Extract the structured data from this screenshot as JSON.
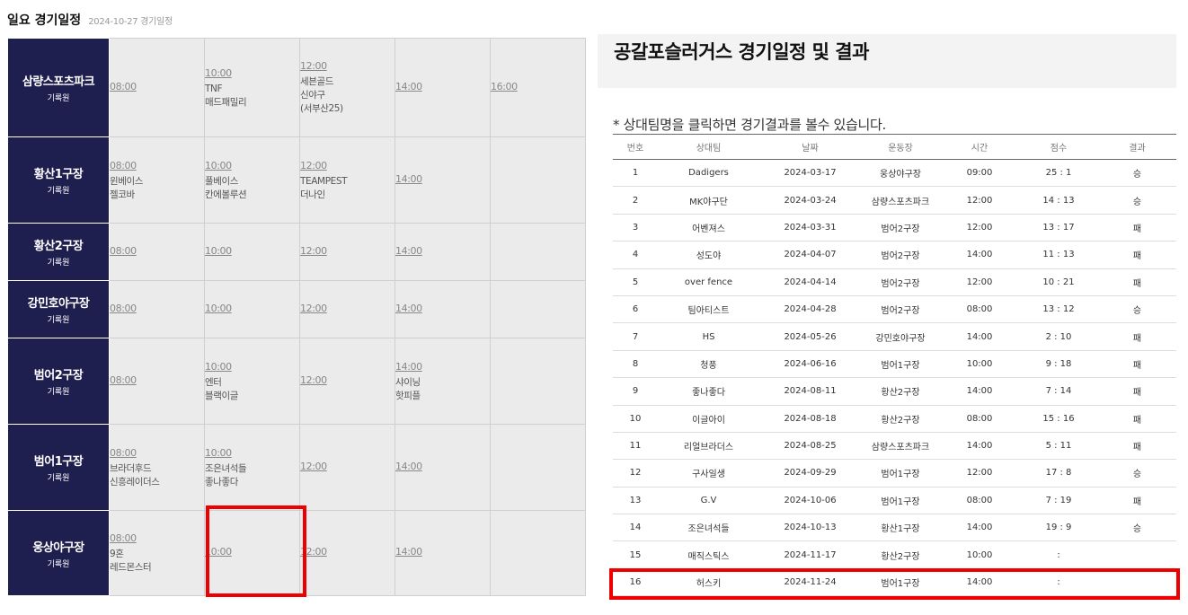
{
  "left": {
    "title": "일요 경기일정",
    "date": "2024-10-27 경기일정",
    "venues": [
      {
        "name": "삼량스포츠파크",
        "sub": "기록원",
        "slots": [
          {
            "time": "08:00",
            "teams": []
          },
          {
            "time": "10:00",
            "teams": [
              "TNF",
              "매드패밀리"
            ]
          },
          {
            "time": "12:00",
            "teams": [
              "세븐골드",
              "신야구",
              "(서부산25)"
            ]
          },
          {
            "time": "14:00",
            "teams": []
          },
          {
            "time": "16:00",
            "teams": []
          }
        ]
      },
      {
        "name": "황산1구장",
        "sub": "기록원",
        "slots": [
          {
            "time": "08:00",
            "teams": [
              "윈베이스",
              "젤코바"
            ]
          },
          {
            "time": "10:00",
            "teams": [
              "풀베이스",
              "칸에볼루션"
            ]
          },
          {
            "time": "12:00",
            "teams": [
              "TEAMPEST",
              "더나인"
            ]
          },
          {
            "time": "14:00",
            "teams": []
          },
          {
            "time": "",
            "teams": []
          }
        ]
      },
      {
        "name": "황산2구장",
        "sub": "기록원",
        "slots": [
          {
            "time": "08:00",
            "teams": []
          },
          {
            "time": "10:00",
            "teams": []
          },
          {
            "time": "12:00",
            "teams": []
          },
          {
            "time": "14:00",
            "teams": []
          },
          {
            "time": "",
            "teams": []
          }
        ]
      },
      {
        "name": "강민호야구장",
        "sub": "기록원",
        "slots": [
          {
            "time": "08:00",
            "teams": []
          },
          {
            "time": "10:00",
            "teams": []
          },
          {
            "time": "12:00",
            "teams": []
          },
          {
            "time": "14:00",
            "teams": []
          },
          {
            "time": "",
            "teams": []
          }
        ]
      },
      {
        "name": "범어2구장",
        "sub": "기록원",
        "slots": [
          {
            "time": "08:00",
            "teams": []
          },
          {
            "time": "10:00",
            "teams": [
              "엔터",
              "블랙이글"
            ]
          },
          {
            "time": "12:00",
            "teams": []
          },
          {
            "time": "14:00",
            "teams": [
              "샤이닝",
              "핫피플"
            ]
          },
          {
            "time": "",
            "teams": []
          }
        ]
      },
      {
        "name": "범어1구장",
        "sub": "기록원",
        "slots": [
          {
            "time": "08:00",
            "teams": [
              "브라더후드",
              "신흥레이더스"
            ]
          },
          {
            "time": "10:00",
            "teams": [
              "조은녀석들",
              "좋나좋다"
            ]
          },
          {
            "time": "12:00",
            "teams": []
          },
          {
            "time": "14:00",
            "teams": []
          },
          {
            "time": "",
            "teams": []
          }
        ]
      },
      {
        "name": "웅상야구장",
        "sub": "기록원",
        "slots": [
          {
            "time": "08:00",
            "teams": [
              "9혼",
              "레드몬스터"
            ]
          },
          {
            "time": "10:00",
            "teams": []
          },
          {
            "time": "12:00",
            "teams": []
          },
          {
            "time": "14:00",
            "teams": []
          },
          {
            "time": "",
            "teams": []
          }
        ]
      }
    ]
  },
  "right": {
    "title": "공갈포슬러거스 경기일정 및 결과",
    "notice": "* 상대팀명을 클릭하면 경기결과를 볼수 있습니다.",
    "columns": [
      "번호",
      "상대팀",
      "날짜",
      "운동장",
      "시간",
      "점수",
      "결과"
    ],
    "rows": [
      [
        "1",
        "Dadigers",
        "2024-03-17",
        "웅상야구장",
        "09:00",
        "25 : 1",
        "승"
      ],
      [
        "2",
        "MK야구단",
        "2024-03-24",
        "삼량스포츠파크",
        "12:00",
        "14 : 13",
        "승"
      ],
      [
        "3",
        "어벤져스",
        "2024-03-31",
        "범어2구장",
        "12:00",
        "13 : 17",
        "패"
      ],
      [
        "4",
        "성도야",
        "2024-04-07",
        "범어2구장",
        "14:00",
        "11 : 13",
        "패"
      ],
      [
        "5",
        "over fence",
        "2024-04-14",
        "범어2구장",
        "12:00",
        "10 : 21",
        "패"
      ],
      [
        "6",
        "팀아티스트",
        "2024-04-28",
        "범어2구장",
        "08:00",
        "13 : 12",
        "승"
      ],
      [
        "7",
        "HS",
        "2024-05-26",
        "강민호야구장",
        "14:00",
        "2 : 10",
        "패"
      ],
      [
        "8",
        "청풍",
        "2024-06-16",
        "범어1구장",
        "10:00",
        "9 : 18",
        "패"
      ],
      [
        "9",
        "좋나좋다",
        "2024-08-11",
        "황산2구장",
        "14:00",
        "7 : 14",
        "패"
      ],
      [
        "10",
        "이글아이",
        "2024-08-18",
        "황산2구장",
        "08:00",
        "15 : 16",
        "패"
      ],
      [
        "11",
        "리얼브라더스",
        "2024-08-25",
        "삼량스포츠파크",
        "14:00",
        "5 : 11",
        "패"
      ],
      [
        "12",
        "구사일생",
        "2024-09-29",
        "범어1구장",
        "12:00",
        "17 : 8",
        "승"
      ],
      [
        "13",
        "G.V",
        "2024-10-06",
        "범어1구장",
        "08:00",
        "7 : 19",
        "패"
      ],
      [
        "14",
        "조은녀석들",
        "2024-10-13",
        "황산1구장",
        "14:00",
        "19 : 9",
        "승"
      ],
      [
        "15",
        "매직스틱스",
        "2024-11-17",
        "황산2구장",
        "10:00",
        ":",
        ""
      ],
      [
        "16",
        "허스키",
        "2024-11-24",
        "범어1구장",
        "14:00",
        ":",
        ""
      ]
    ]
  },
  "colors": {
    "venue_bg": "#1f1f4f",
    "highlight": "#ee0000"
  }
}
